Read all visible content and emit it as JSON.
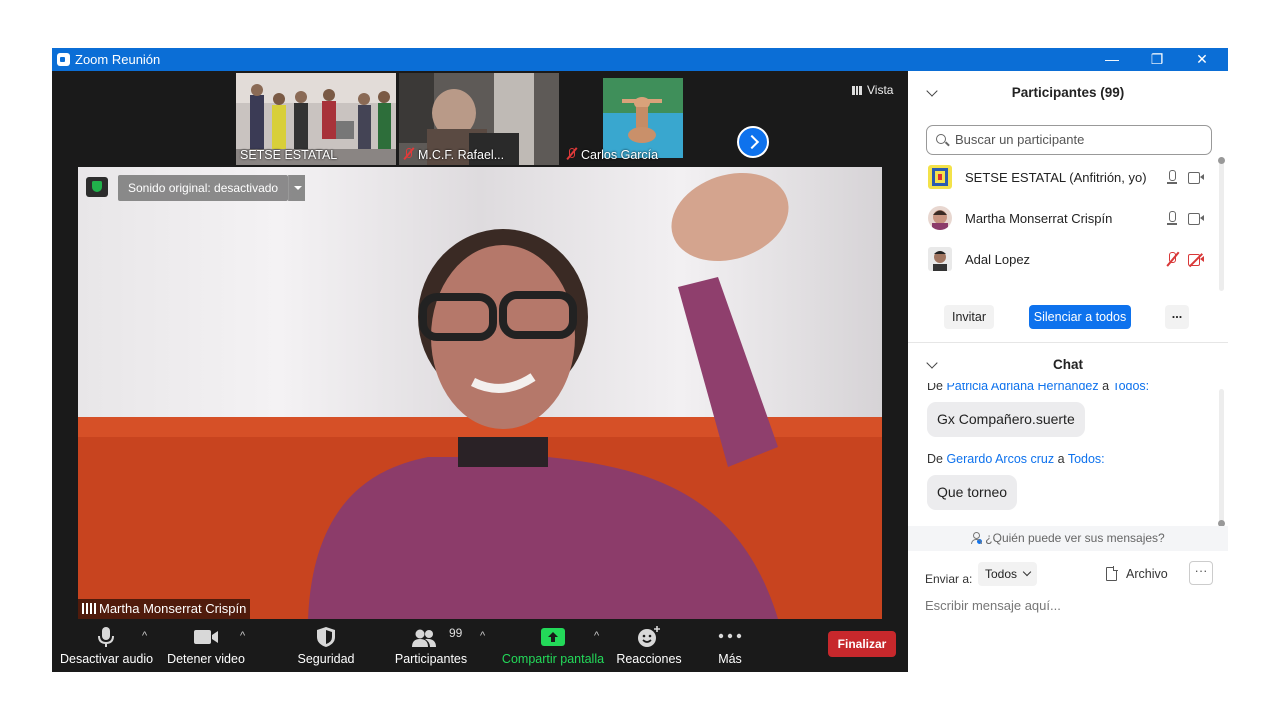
{
  "window": {
    "title": "Zoom Reunión",
    "minimize": "—",
    "maximize": "❐",
    "close": "✕"
  },
  "meeting": {
    "view_label": "Vista",
    "thumbnails": [
      {
        "label": "SETSE ESTATAL",
        "muted": false
      },
      {
        "label": "M.C.F. Rafael...",
        "muted": true
      },
      {
        "label": "Carlos García",
        "muted": true
      }
    ],
    "sound_button": "Sonido original: desactivado",
    "active_speaker": "Martha Monserrat Crispín"
  },
  "toolbar": {
    "audio": "Desactivar audio",
    "video": "Detener video",
    "security": "Seguridad",
    "participants": "Participantes",
    "participants_count": "99",
    "share": "Compartir pantalla",
    "reactions": "Reacciones",
    "more": "Más",
    "end": "Finalizar",
    "caret": "^"
  },
  "participants_panel": {
    "title": "Participantes (99)",
    "search_placeholder": "Buscar un participante",
    "participants": [
      {
        "name": "SETSE ESTATAL (Anfitrión, yo)",
        "mic": "on",
        "video": "on"
      },
      {
        "name": "Martha Monserrat Crispín",
        "mic": "on",
        "video": "on"
      },
      {
        "name": "Adal Lopez",
        "mic": "off",
        "video": "off"
      }
    ],
    "invite": "Invitar",
    "mute_all": "Silenciar a todos",
    "more": "..."
  },
  "chat": {
    "title": "Chat",
    "messages": [
      {
        "prefix": "De ",
        "from": "Patricia Adriana Hernández",
        "mid": " a ",
        "to": "Todos:",
        "text": "Gx Compañero.suerte"
      },
      {
        "prefix": "De ",
        "from": "Gerardo Arcos cruz",
        "mid": " a ",
        "to": "Todos:",
        "text": "Que torneo"
      }
    ],
    "who_can_see": "¿Quién puede ver sus mensajes?",
    "send_to_label": "Enviar a:",
    "send_to_value": "Todos",
    "file_label": "Archivo",
    "more": "···",
    "input_placeholder": "Escribir mensaje aquí..."
  },
  "colors": {
    "titlebar": "#0b6ed6",
    "accent": "#0e72ed",
    "end_button": "#c7282c",
    "share_green": "#23d959",
    "muted_red": "#e03a3a"
  }
}
